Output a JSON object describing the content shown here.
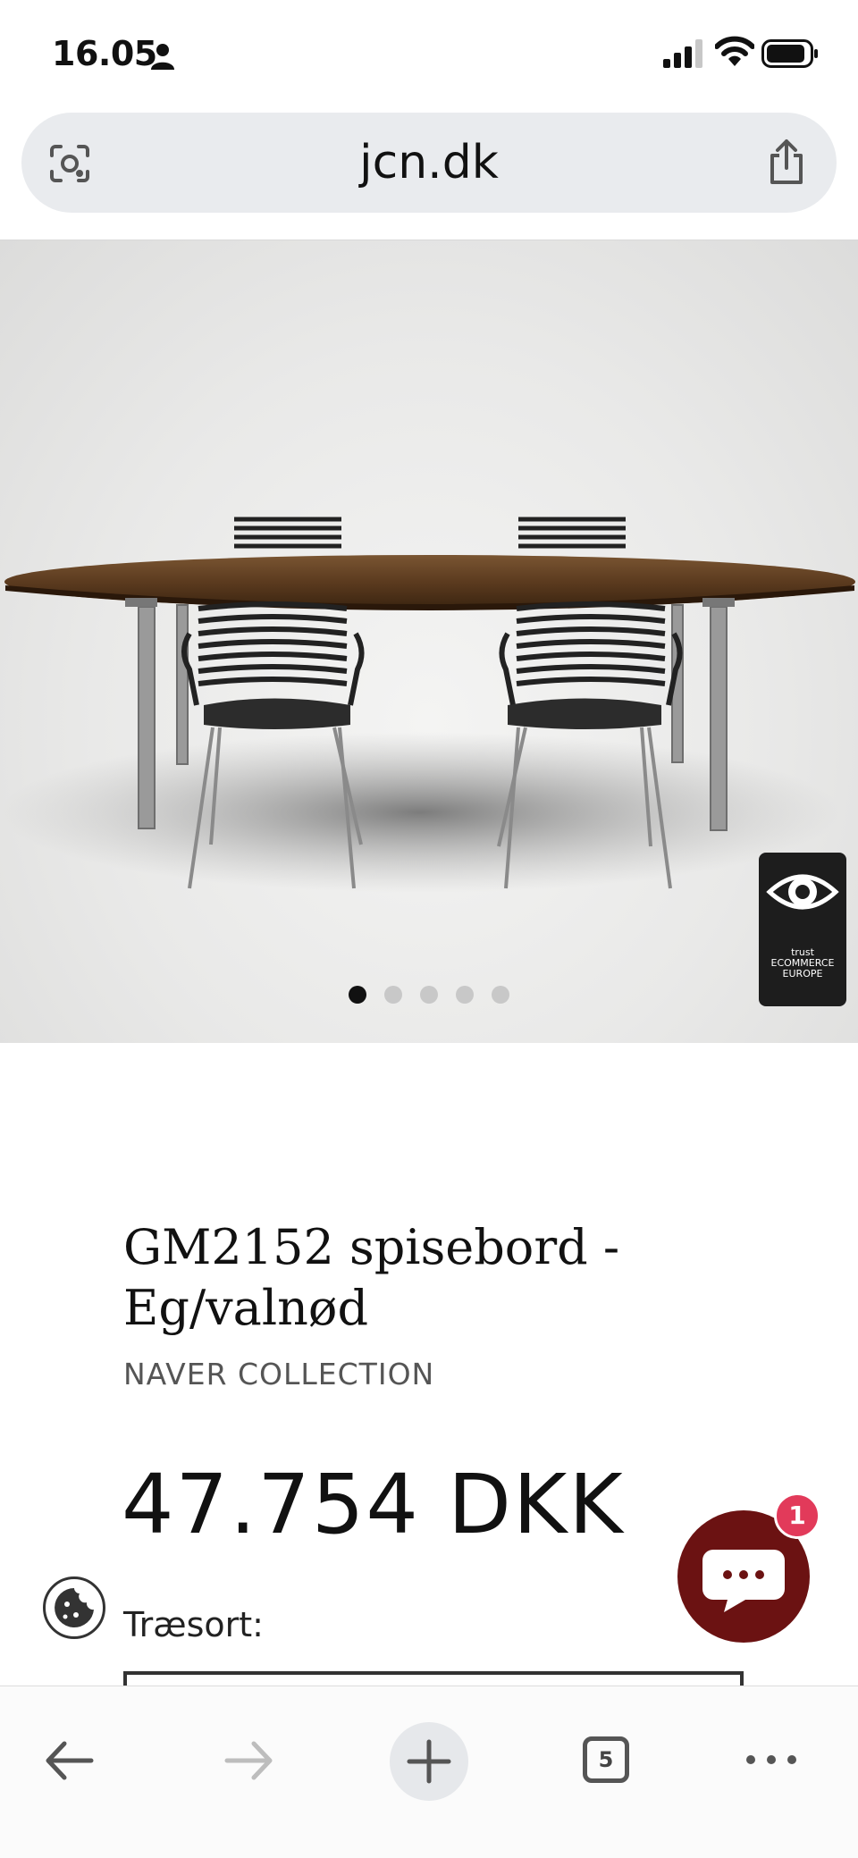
{
  "status_bar": {
    "time": "16.05"
  },
  "browser": {
    "url": "jcn.dk",
    "tab_count": "5"
  },
  "gallery": {
    "slides": 5,
    "active_index": 0,
    "badge_text": "trust ECOMMERCE EUROPE"
  },
  "product": {
    "title": "GM2152 spisebord - Eg/valnød",
    "vendor": "NAVER COLLECTION",
    "price": "47.754 DKK",
    "option_label": "Træsort:"
  },
  "chat": {
    "unread": "1"
  },
  "colors": {
    "chat_bg": "#6b1212",
    "badge": "#e23a5a",
    "url_bar": "#e9ebee"
  },
  "icons": [
    "person-icon",
    "signal-icon",
    "wifi-icon",
    "battery-icon",
    "lens-icon",
    "share-icon",
    "cookie-icon",
    "chat-icon",
    "back-arrow-icon",
    "forward-arrow-icon",
    "plus-icon",
    "more-icon"
  ]
}
